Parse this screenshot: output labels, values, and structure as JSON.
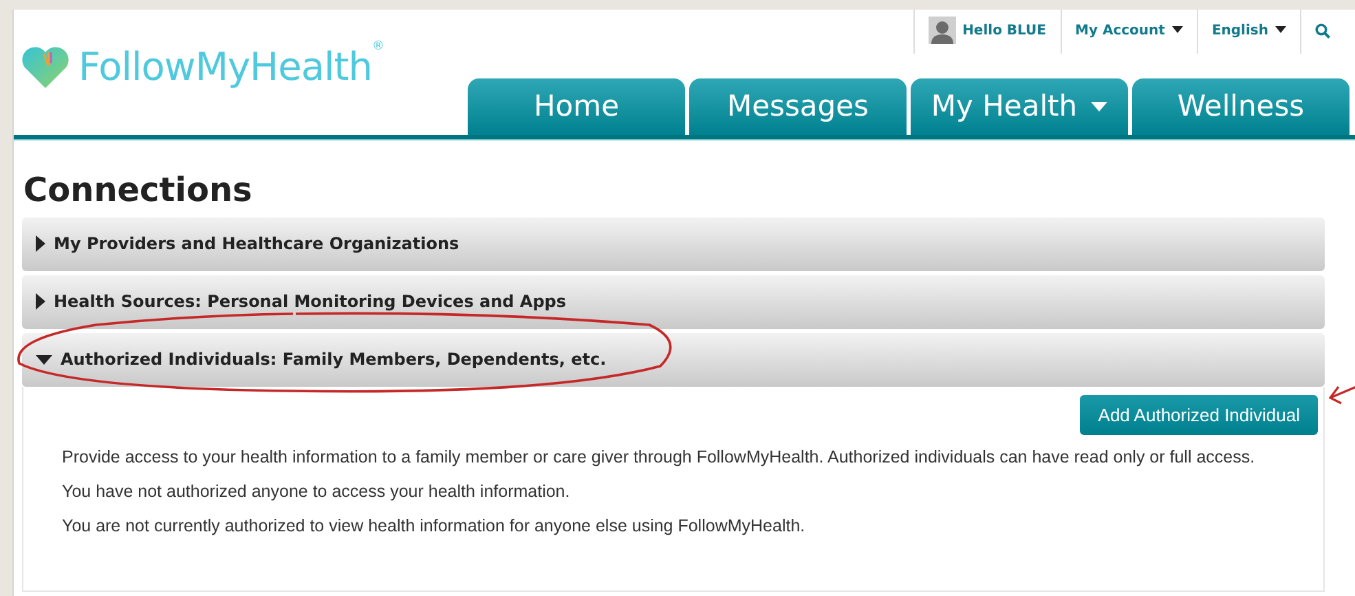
{
  "top_bar": {
    "greeting": "Hello BLUE",
    "menus": [
      {
        "label": "My Account"
      },
      {
        "label": "English"
      }
    ]
  },
  "logo": {
    "text": "FollowMyHealth",
    "trademark": "®"
  },
  "nav_tabs": [
    {
      "label": "Home",
      "has_menu": false
    },
    {
      "label": "Messages",
      "has_menu": false
    },
    {
      "label": "My Health",
      "has_menu": true
    },
    {
      "label": "Wellness",
      "has_menu": false
    }
  ],
  "page_title": "Connections",
  "sections": [
    {
      "title": "My Providers and Healthcare Organizations",
      "expanded": false
    },
    {
      "title": "Health Sources: Personal Monitoring Devices and Apps",
      "expanded": false
    },
    {
      "title": "Authorized Individuals: Family Members, Dependents, etc.",
      "expanded": true,
      "button": "Add Authorized Individual",
      "paragraphs": [
        "Provide access to your health information to a family member or care giver through FollowMyHealth. Authorized individuals can have read only or full access.",
        "You have not authorized anyone to access your health information.",
        "You are not currently authorized to view health information for anyone else using FollowMyHealth."
      ]
    }
  ]
}
